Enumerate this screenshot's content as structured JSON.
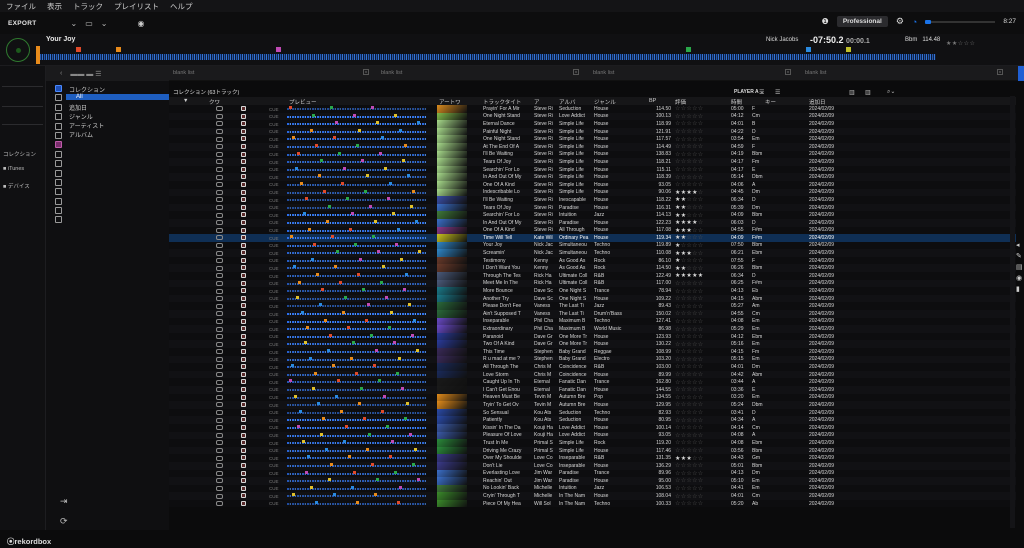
{
  "menu": [
    "ファイル",
    "表示",
    "トラック",
    "プレイリスト",
    "ヘルプ"
  ],
  "toolbar": {
    "export_label": "EXPORT",
    "mode_label": "Professional",
    "clock": "8:27"
  },
  "deck": {
    "title": "Your Joy",
    "artist": "Nick Jacobs",
    "remaining": "-07:50.2",
    "elapsed": "00:00.1",
    "bpm_label": "Bbm",
    "bpm": "114.48"
  },
  "sidebar": {
    "collection_label": "コレクション",
    "itunes_label": "iTunes",
    "devices_label": "デバイス"
  },
  "tree": {
    "items": [
      "コレクション",
      "All",
      "追加日",
      "ジャンル",
      "アーティスト",
      "アルバム"
    ]
  },
  "panes": [
    "blank list",
    "blank list",
    "blank list",
    "blank list",
    "blank list"
  ],
  "collection": {
    "title": "コレクション (63トラック)",
    "player": "PLAYER A"
  },
  "columns": {
    "color": "クワ",
    "preview": "プレビュー",
    "artwork": "アートワ",
    "title": "トラックタイト",
    "artist": "ア",
    "album": "アルバ",
    "genre": "ジャンル",
    "bpm": "BP",
    "rating": "評価",
    "time": "時間",
    "key": "キー",
    "added": "追加日"
  },
  "tracks": [
    {
      "title": "Prayin' For A Mir",
      "artist": "Steve Ri",
      "album": "Seduction",
      "genre": "House",
      "bpm": "114.50",
      "rating": 0,
      "time": "05:00",
      "key": "F",
      "added": "2024/02/09",
      "art": "#d98a1e"
    },
    {
      "title": "One Night Stand",
      "artist": "Steve Ri",
      "album": "Love Addict",
      "genre": "House",
      "bpm": "100.13",
      "rating": 0,
      "time": "04:12",
      "key": "Cm",
      "added": "2024/02/09",
      "art": "#7fb94a"
    },
    {
      "title": "Eternal Dance",
      "artist": "Steve Ri",
      "album": "Simple Life",
      "genre": "House",
      "bpm": "118.99",
      "rating": 0,
      "time": "04:01",
      "key": "B",
      "added": "2024/02/09",
      "art": "#a7d98a"
    },
    {
      "title": "Painful Night",
      "artist": "Steve Ri",
      "album": "Simple Life",
      "genre": "House",
      "bpm": "121.91",
      "rating": 0,
      "time": "04:22",
      "key": "D",
      "added": "2024/02/09",
      "art": "#a7d98a"
    },
    {
      "title": "One Night Stand",
      "artist": "Steve Ri",
      "album": "Simple Life",
      "genre": "House",
      "bpm": "117.57",
      "rating": 0,
      "time": "03:54",
      "key": "Em",
      "added": "2024/02/09",
      "art": "#a7d98a"
    },
    {
      "title": "At The End Of A",
      "artist": "Steve Ri",
      "album": "Simple Life",
      "genre": "House",
      "bpm": "114.49",
      "rating": 0,
      "time": "04:59",
      "key": "F",
      "added": "2024/02/09",
      "art": "#a7d98a"
    },
    {
      "title": "I'll Be Waiting",
      "artist": "Steve Ri",
      "album": "Simple Life",
      "genre": "House",
      "bpm": "138.83",
      "rating": 0,
      "time": "04:19",
      "key": "Bbm",
      "added": "2024/02/09",
      "art": "#a7d98a"
    },
    {
      "title": "Tears Of Joy",
      "artist": "Steve Ri",
      "album": "Simple Life",
      "genre": "House",
      "bpm": "118.21",
      "rating": 0,
      "time": "04:17",
      "key": "Fm",
      "added": "2024/02/09",
      "art": "#a7d98a"
    },
    {
      "title": "Searchin' For Lo",
      "artist": "Steve Ri",
      "album": "Simple Life",
      "genre": "House",
      "bpm": "115.11",
      "rating": 0,
      "time": "04:17",
      "key": "E",
      "added": "2024/02/09",
      "art": "#a7d98a"
    },
    {
      "title": "In And Out Of My",
      "artist": "Steve Ri",
      "album": "Simple Life",
      "genre": "House",
      "bpm": "118.39",
      "rating": 0,
      "time": "05:14",
      "key": "Dbm",
      "added": "2024/02/09",
      "art": "#a7d98a"
    },
    {
      "title": "One Of A Kind",
      "artist": "Steve Ri",
      "album": "Simple Life",
      "genre": "House",
      "bpm": "93.05",
      "rating": 0,
      "time": "04:06",
      "key": "A",
      "added": "2024/02/09",
      "art": "#a7d98a"
    },
    {
      "title": "Indescribable Lo",
      "artist": "Steve Ri",
      "album": "Simple Life",
      "genre": "House",
      "bpm": "90.06",
      "rating": 4,
      "time": "04:45",
      "key": "Dm",
      "added": "2024/02/09",
      "art": "#a7d98a"
    },
    {
      "title": "I'll Be Waiting",
      "artist": "Steve Ri",
      "album": "Inescapable",
      "genre": "House",
      "bpm": "118.22",
      "rating": 2,
      "time": "06:34",
      "key": "D",
      "added": "2024/02/09",
      "art": "#3a4fa8"
    },
    {
      "title": "Tears Of Joy",
      "artist": "Steve Ri",
      "album": "Paradise",
      "genre": "House",
      "bpm": "116.31",
      "rating": 2,
      "time": "05:39",
      "key": "Dm",
      "added": "2024/02/09",
      "art": "#3a6ec8"
    },
    {
      "title": "Searchin' For Lo",
      "artist": "Steve Ri",
      "album": "Intuition",
      "genre": "Jazz",
      "bpm": "114.13",
      "rating": 2,
      "time": "04:09",
      "key": "Bbm",
      "added": "2024/02/09",
      "art": "#3f7a3a"
    },
    {
      "title": "In And Out Of My",
      "artist": "Steve Ri",
      "album": "Paradise",
      "genre": "House",
      "bpm": "122.23",
      "rating": 4,
      "time": "06:03",
      "key": "D",
      "added": "2024/02/09",
      "art": "#3a6ec8"
    },
    {
      "title": "One Of A Kind",
      "artist": "Steve Ri",
      "album": "All Through",
      "genre": "House",
      "bpm": "117.08",
      "rating": 3,
      "time": "04:55",
      "key": "F#m",
      "added": "2024/02/09",
      "art": "#8a3a8a"
    },
    {
      "title": "Time Will Tell",
      "artist": "Kate Wil",
      "album": "Ordinary Pea",
      "genre": "House",
      "bpm": "119.34",
      "rating": 2,
      "time": "04:09",
      "key": "F#m",
      "added": "2024/02/09",
      "art": "#c9c21e",
      "selected": true
    },
    {
      "title": "Your Joy",
      "artist": "Nick Jac",
      "album": "Simultaneou",
      "genre": "Techno",
      "bpm": "119.89",
      "rating": 1,
      "time": "07:50",
      "key": "Bbm",
      "added": "2024/02/09",
      "art": "#2f86c8"
    },
    {
      "title": "Screamin'",
      "artist": "Nick Jac",
      "album": "Simultaneou",
      "genre": "Techno",
      "bpm": "110.08",
      "rating": 3,
      "time": "06:21",
      "key": "Ebm",
      "added": "2024/02/09",
      "art": "#2f86c8"
    },
    {
      "title": "Testimony",
      "artist": "Kenny",
      "album": "As Good As",
      "genre": "Rock",
      "bpm": "86.10",
      "rating": 1,
      "time": "07:55",
      "key": "F",
      "added": "2024/02/09",
      "art": "#6a3a2a"
    },
    {
      "title": "I Don't Want You",
      "artist": "Kenny",
      "album": "As Good As",
      "genre": "Rock",
      "bpm": "114.50",
      "rating": 2,
      "time": "06:26",
      "key": "Bbm",
      "added": "2024/02/09",
      "art": "#6a3a2a"
    },
    {
      "title": "Through The Tes",
      "artist": "Rick Ha",
      "album": "Ultimate Coll",
      "genre": "R&B",
      "bpm": "122.49",
      "rating": 5,
      "time": "06:34",
      "key": "D",
      "added": "2024/02/09",
      "art": "#4a5a7a"
    },
    {
      "title": "Meet Me In The",
      "artist": "Rick Ha",
      "album": "Ultimate Coll",
      "genre": "R&B",
      "bpm": "117.00",
      "rating": 0,
      "time": "06:25",
      "key": "F#m",
      "added": "2024/02/09",
      "art": "#4a5a7a"
    },
    {
      "title": "More Bounce",
      "artist": "Dave Sc",
      "album": "One Night S",
      "genre": "Trance",
      "bpm": "78.94",
      "rating": 0,
      "time": "04:13",
      "key": "Eb",
      "added": "2024/02/09",
      "art": "#1a7a8a"
    },
    {
      "title": "Another Try",
      "artist": "Dave Sc",
      "album": "One Night S",
      "genre": "House",
      "bpm": "109.22",
      "rating": 0,
      "time": "04:15",
      "key": "Abm",
      "added": "2024/02/09",
      "art": "#1a7a8a"
    },
    {
      "title": "Please Don't Fee",
      "artist": "Vaness",
      "album": "The Last Ti",
      "genre": "Jazz",
      "bpm": "89.43",
      "rating": 0,
      "time": "05:27",
      "key": "Am",
      "added": "2024/02/09",
      "art": "#2a6a3a"
    },
    {
      "title": "Ain't Supposed T",
      "artist": "Vaness",
      "album": "The Last Ti",
      "genre": "Drum'n'Bass",
      "bpm": "150.02",
      "rating": 0,
      "time": "04:55",
      "key": "Cm",
      "added": "2024/02/09",
      "art": "#2a6a3a"
    },
    {
      "title": "Inseparable",
      "artist": "Phil Cha",
      "album": "Maximum B",
      "genre": "Techno",
      "bpm": "127.41",
      "rating": 0,
      "time": "04:08",
      "key": "Em",
      "added": "2024/02/09",
      "art": "#6a4ac8"
    },
    {
      "title": "Extraordinary",
      "artist": "Phil Cha",
      "album": "Maximum B",
      "genre": "World Music",
      "bpm": "86.98",
      "rating": 0,
      "time": "05:29",
      "key": "Em",
      "added": "2024/02/09",
      "art": "#6a4ac8"
    },
    {
      "title": "Paranoid",
      "artist": "Dave Gr",
      "album": "One More Tr",
      "genre": "House",
      "bpm": "123.93",
      "rating": 0,
      "time": "04:12",
      "key": "Ebm",
      "added": "2024/02/09",
      "art": "#2a3a9a"
    },
    {
      "title": "Two Of A Kind",
      "artist": "Dave Gr",
      "album": "One More Tr",
      "genre": "House",
      "bpm": "130.22",
      "rating": 0,
      "time": "05:16",
      "key": "Em",
      "added": "2024/02/09",
      "art": "#2a3a9a"
    },
    {
      "title": "This Time",
      "artist": "Stephen",
      "album": "Baby Grand",
      "genre": "Reggae",
      "bpm": "108.99",
      "rating": 0,
      "time": "04:15",
      "key": "Fm",
      "added": "2024/02/09",
      "art": "#3a2a5a"
    },
    {
      "title": "R u mad at me ?",
      "artist": "Stephen",
      "album": "Baby Grand",
      "genre": "Electro",
      "bpm": "103.20",
      "rating": 0,
      "time": "05:15",
      "key": "Em",
      "added": "2024/02/09",
      "art": "#3a2a5a"
    },
    {
      "title": "All Through The",
      "artist": "Chris M",
      "album": "Coincidence",
      "genre": "R&B",
      "bpm": "103.00",
      "rating": 0,
      "time": "04:01",
      "key": "Dm",
      "added": "2024/02/09",
      "art": "#1a2a5a"
    },
    {
      "title": "Love Storm",
      "artist": "Chris M",
      "album": "Coincidence",
      "genre": "House",
      "bpm": "89.99",
      "rating": 0,
      "time": "04:42",
      "key": "Abm",
      "added": "2024/02/09",
      "art": "#1a2a5a"
    },
    {
      "title": "Caught Up In Th",
      "artist": "Eternal",
      "album": "Fanatic Dan",
      "genre": "Trance",
      "bpm": "162.80",
      "rating": 0,
      "time": "03:44",
      "key": "A",
      "added": "2024/02/09",
      "art": "#1a1a1a"
    },
    {
      "title": "I Can't Get Enou",
      "artist": "Eternal",
      "album": "Fanatic Dan",
      "genre": "House",
      "bpm": "144.55",
      "rating": 0,
      "time": "03:36",
      "key": "E",
      "added": "2024/02/09",
      "art": "#1a1a1a"
    },
    {
      "title": "Heaven Must Be",
      "artist": "Tevin M",
      "album": "Autumn Bre",
      "genre": "Pop",
      "bpm": "134.55",
      "rating": 0,
      "time": "03:20",
      "key": "Em",
      "added": "2024/02/09",
      "art": "#e08a1a"
    },
    {
      "title": "Tryin' To Get Ov",
      "artist": "Tevin M",
      "album": "Autumn Bre",
      "genre": "House",
      "bpm": "129.95",
      "rating": 0,
      "time": "05:24",
      "key": "Dbm",
      "added": "2024/02/09",
      "art": "#e08a1a"
    },
    {
      "title": "So Sensual",
      "artist": "Kou Ats",
      "album": "Seduction",
      "genre": "Techno",
      "bpm": "82.93",
      "rating": 0,
      "time": "03:41",
      "key": "D",
      "added": "2024/02/09",
      "art": "#2a4aa8"
    },
    {
      "title": "Patiently",
      "artist": "Kou Ats",
      "album": "Seduction",
      "genre": "House",
      "bpm": "80.95",
      "rating": 0,
      "time": "04:34",
      "key": "A",
      "added": "2024/02/09",
      "art": "#2a4aa8"
    },
    {
      "title": "Kissin' In The Da",
      "artist": "Kouji Ha",
      "album": "Love Addict",
      "genre": "House",
      "bpm": "100.14",
      "rating": 0,
      "time": "04:14",
      "key": "Cm",
      "added": "2024/02/09",
      "art": "#3a5aa8"
    },
    {
      "title": "Pleasure Of Love",
      "artist": "Kouji Ha",
      "album": "Love Addict",
      "genre": "House",
      "bpm": "93.05",
      "rating": 0,
      "time": "04:08",
      "key": "A",
      "added": "2024/02/09",
      "art": "#3a5aa8"
    },
    {
      "title": "Trust In Me",
      "artist": "Primal S",
      "album": "Simple Life",
      "genre": "Rock",
      "bpm": "119.20",
      "rating": 0,
      "time": "04:08",
      "key": "Ebm",
      "added": "2024/02/09",
      "art": "#2a8a3a"
    },
    {
      "title": "Driving Me Crazy",
      "artist": "Primal S",
      "album": "Simple Life",
      "genre": "House",
      "bpm": "117.46",
      "rating": 0,
      "time": "03:56",
      "key": "Bbm",
      "added": "2024/02/09",
      "art": "#2a8a3a"
    },
    {
      "title": "Over My Shoulde",
      "artist": "Love Co",
      "album": "Inseparable",
      "genre": "R&B",
      "bpm": "131.35",
      "rating": 3,
      "time": "04:43",
      "key": "Gm",
      "added": "2024/02/09",
      "art": "#3a3a8a"
    },
    {
      "title": "Don't Lie",
      "artist": "Love Co",
      "album": "Inseparable",
      "genre": "House",
      "bpm": "136.29",
      "rating": 0,
      "time": "05:01",
      "key": "Bbm",
      "added": "2024/02/09",
      "art": "#3a3a8a"
    },
    {
      "title": "Everlasting Love",
      "artist": "Jim War",
      "album": "Paradise",
      "genre": "Trance",
      "bpm": "89.96",
      "rating": 0,
      "time": "04:13",
      "key": "Dm",
      "added": "2024/02/09",
      "art": "#3a6ec8"
    },
    {
      "title": "Reachin' Out",
      "artist": "Jim War",
      "album": "Paradise",
      "genre": "House",
      "bpm": "95.00",
      "rating": 0,
      "time": "05:10",
      "key": "Em",
      "added": "2024/02/09",
      "art": "#3a6ec8"
    },
    {
      "title": "No Lookin' Back",
      "artist": "Michelle",
      "album": "Intuition",
      "genre": "Jazz",
      "bpm": "106.53",
      "rating": 0,
      "time": "04:41",
      "key": "Em",
      "added": "2024/02/09",
      "art": "#3f7a3a"
    },
    {
      "title": "Cryin' Through T",
      "artist": "Michelle",
      "album": "In The Nam",
      "genre": "House",
      "bpm": "108.04",
      "rating": 0,
      "time": "04:01",
      "key": "Cm",
      "added": "2024/02/09",
      "art": "#3a8a2a"
    },
    {
      "title": "Piece Of My Hea",
      "artist": "Will Sol",
      "album": "In The Nam",
      "genre": "Techno",
      "bpm": "100.33",
      "rating": 0,
      "time": "05:20",
      "key": "Ab",
      "added": "2024/02/09",
      "art": "#3a8a2a"
    }
  ],
  "brand": {
    "name": "rekordbox"
  }
}
